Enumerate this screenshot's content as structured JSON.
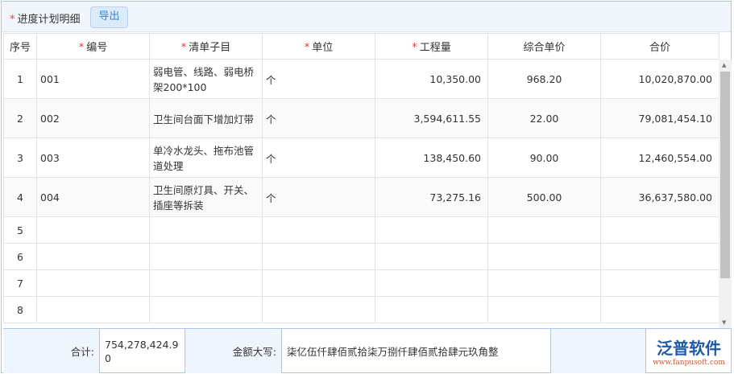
{
  "toolbar": {
    "title": "进度计划明细",
    "export_label": "导出"
  },
  "columns": [
    "序号",
    "编号",
    "清单子目",
    "单位",
    "工程量",
    "综合单价",
    "合价"
  ],
  "required_columns": [
    1,
    2,
    3,
    4
  ],
  "rows": [
    {
      "no": "1",
      "code": "001",
      "item": "弱电管、线路、弱电桥架200*100",
      "unit": "个",
      "qty": "10,350.00",
      "price": "968.20",
      "total": "10,020,870.00"
    },
    {
      "no": "2",
      "code": "002",
      "item": "卫生间台面下增加灯带",
      "unit": "个",
      "qty": "3,594,611.55",
      "price": "22.00",
      "total": "79,081,454.10"
    },
    {
      "no": "3",
      "code": "003",
      "item": "单冷水龙头、拖布池管道处理",
      "unit": "个",
      "qty": "138,450.60",
      "price": "90.00",
      "total": "12,460,554.00"
    },
    {
      "no": "4",
      "code": "004",
      "item": "卫生间原灯具、开关、插座等拆装",
      "unit": "个",
      "qty": "73,275.16",
      "price": "500.00",
      "total": "36,637,580.00"
    }
  ],
  "empty_rows": [
    "5",
    "6",
    "7",
    "8"
  ],
  "footer": {
    "sum_label": "合计:",
    "sum_value": "754,278,424.90",
    "caps_label": "金额大写:",
    "caps_value": "柒亿伍仟肆佰贰拾柒万捌仟肆佰贰拾肆元玖角整"
  },
  "logo": {
    "name": "泛普软件",
    "url": "www.fanpusoft.com"
  },
  "colors": {
    "required": "#e4393c",
    "accent": "#3a86d3",
    "border": "#a9c7e8"
  }
}
